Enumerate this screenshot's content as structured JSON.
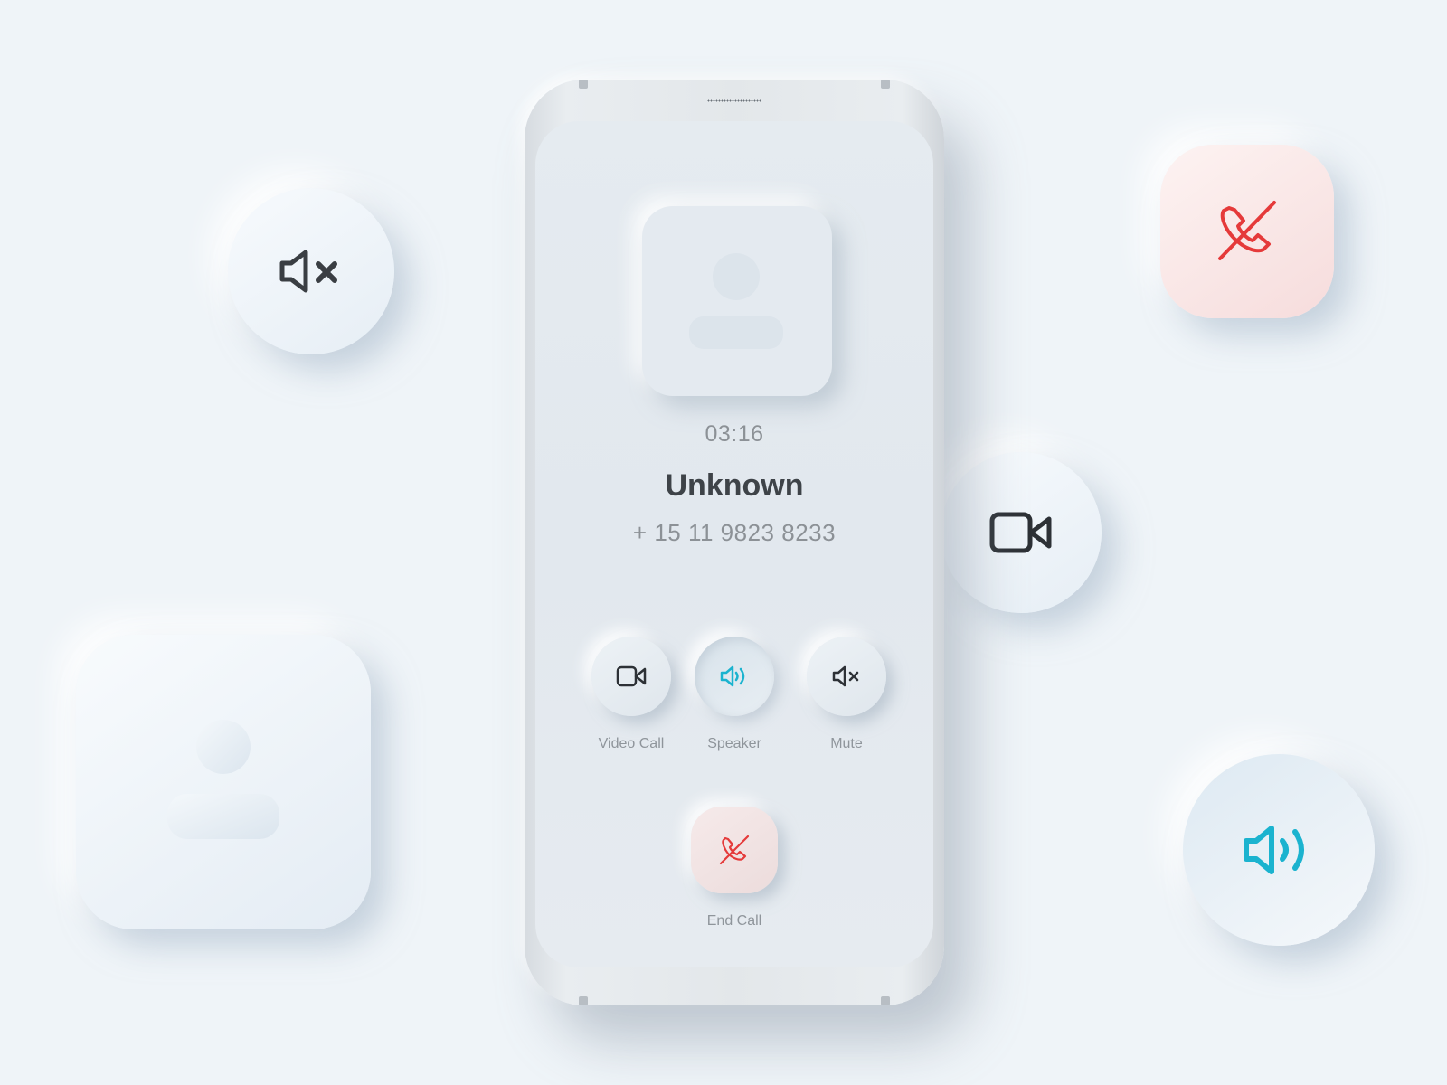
{
  "call": {
    "timer": "03:16",
    "caller_name": "Unknown",
    "caller_number": "+ 15 11 9823 8233"
  },
  "controls": {
    "video_call_label": "Video Call",
    "speaker_label": "Speaker",
    "mute_label": "Mute",
    "end_call_label": "End Call"
  },
  "state": {
    "speaker_active": true
  },
  "icons": {
    "video": "video-camera-icon",
    "speaker": "speaker-volume-icon",
    "mute": "speaker-muted-icon",
    "end_call": "phone-hangup-icon",
    "avatar": "user-avatar-icon"
  },
  "colors": {
    "background": "#eff4f8",
    "accent_speaker": "#1bb3cf",
    "end_call_red": "#e53a3a",
    "icon_dark": "#2d3136",
    "text_dark": "#3e4348",
    "text_muted": "#8c9196"
  }
}
